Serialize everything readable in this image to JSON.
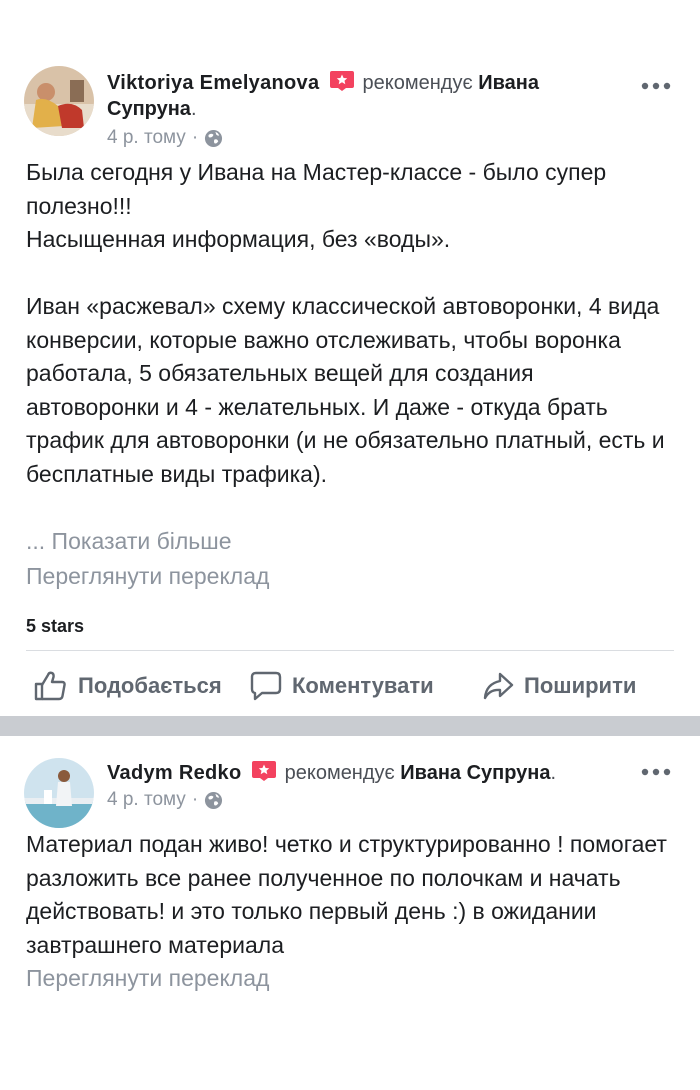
{
  "posts": [
    {
      "author": "Viktoriya  Emelyanova",
      "verb": "рекомендує",
      "page_name": "Ивана Супруна",
      "page_suffix": ".",
      "time": "4 р. тому",
      "separator": "·",
      "body": "Была сегодня у Ивана на Мастер-классе - было супер полезно!!!\nНасыщенная информация, без «воды».\n\nИван «расжевал» схему классической автоворонки, 4 вида конверсии, которые важно отслеживать, чтобы воронка работала, 5 обязательных вещей для создания автоворонки и 4 - желательных. И даже - откуда брать трафик для автоворонки (и не обязательно платный, есть и бесплатные виды трафика).",
      "see_more": "... Показати більше",
      "translate": "Переглянути переклад",
      "stars": "5 stars",
      "actions": {
        "like": "Подобається",
        "comment": "Коментувати",
        "share": "Поширити"
      }
    },
    {
      "author": "Vadym Redko",
      "verb": "рекомендує",
      "page_name": "Ивана Супруна",
      "page_suffix": ".",
      "time": "4 р. тому",
      "separator": "·",
      "body": "Материал подан живо! четко и структурированно ! помогает разложить все ранее полученное по полочкам и начать действовать! и это только первый день :) в ожидании завтрашнего материала",
      "translate": "Переглянути переклад"
    }
  ],
  "colors": {
    "badge": "#f3425f",
    "secondary_text": "#8d949e",
    "action_text": "#606770",
    "separator": "#c9ccd1"
  },
  "icons": {
    "badge": "recommend-badge-icon",
    "globe": "globe-icon",
    "more": "more-dots-icon",
    "like": "thumbs-up-icon",
    "comment": "comment-bubble-icon",
    "share": "share-arrow-icon"
  }
}
